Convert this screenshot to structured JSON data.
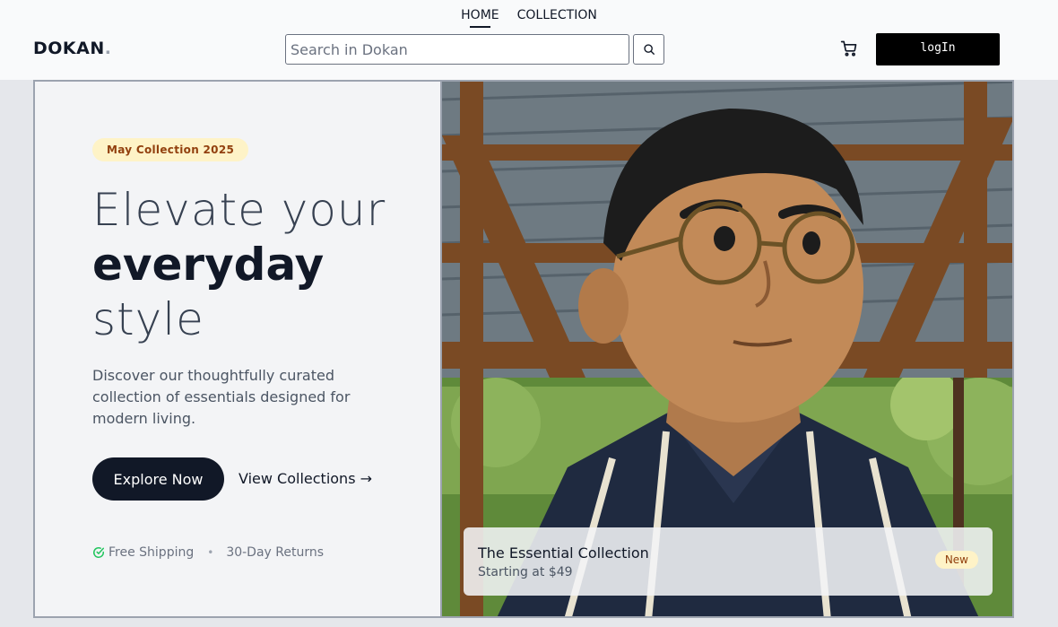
{
  "nav": {
    "links": [
      {
        "label": "HOME",
        "active": true
      },
      {
        "label": "COLLECTION",
        "active": false
      }
    ]
  },
  "header": {
    "logo_text": "DOKAN",
    "logo_dot": ".",
    "search_placeholder": "Search in Dokan",
    "search_icon": "search-icon",
    "cart_icon": "cart-icon",
    "login_label": "logIn"
  },
  "hero": {
    "badge": "May Collection 2025",
    "headline_line1": "Elevate your",
    "headline_line2": "everyday",
    "headline_line3": "style",
    "description": "Discover our thoughtfully curated collection of essentials designed for modern living.",
    "explore_label": "Explore Now",
    "view_label": "View Collections →",
    "perks": [
      "Free Shipping",
      "30-Day Returns"
    ],
    "perk_separator": "•"
  },
  "feature_card": {
    "title": "The Essential Collection",
    "subtitle": "Starting at $49",
    "badge": "New"
  },
  "colors": {
    "accent_dark": "#111827",
    "badge_bg": "#fef3c7",
    "badge_text": "#92400e",
    "check_green": "#22c55e"
  }
}
